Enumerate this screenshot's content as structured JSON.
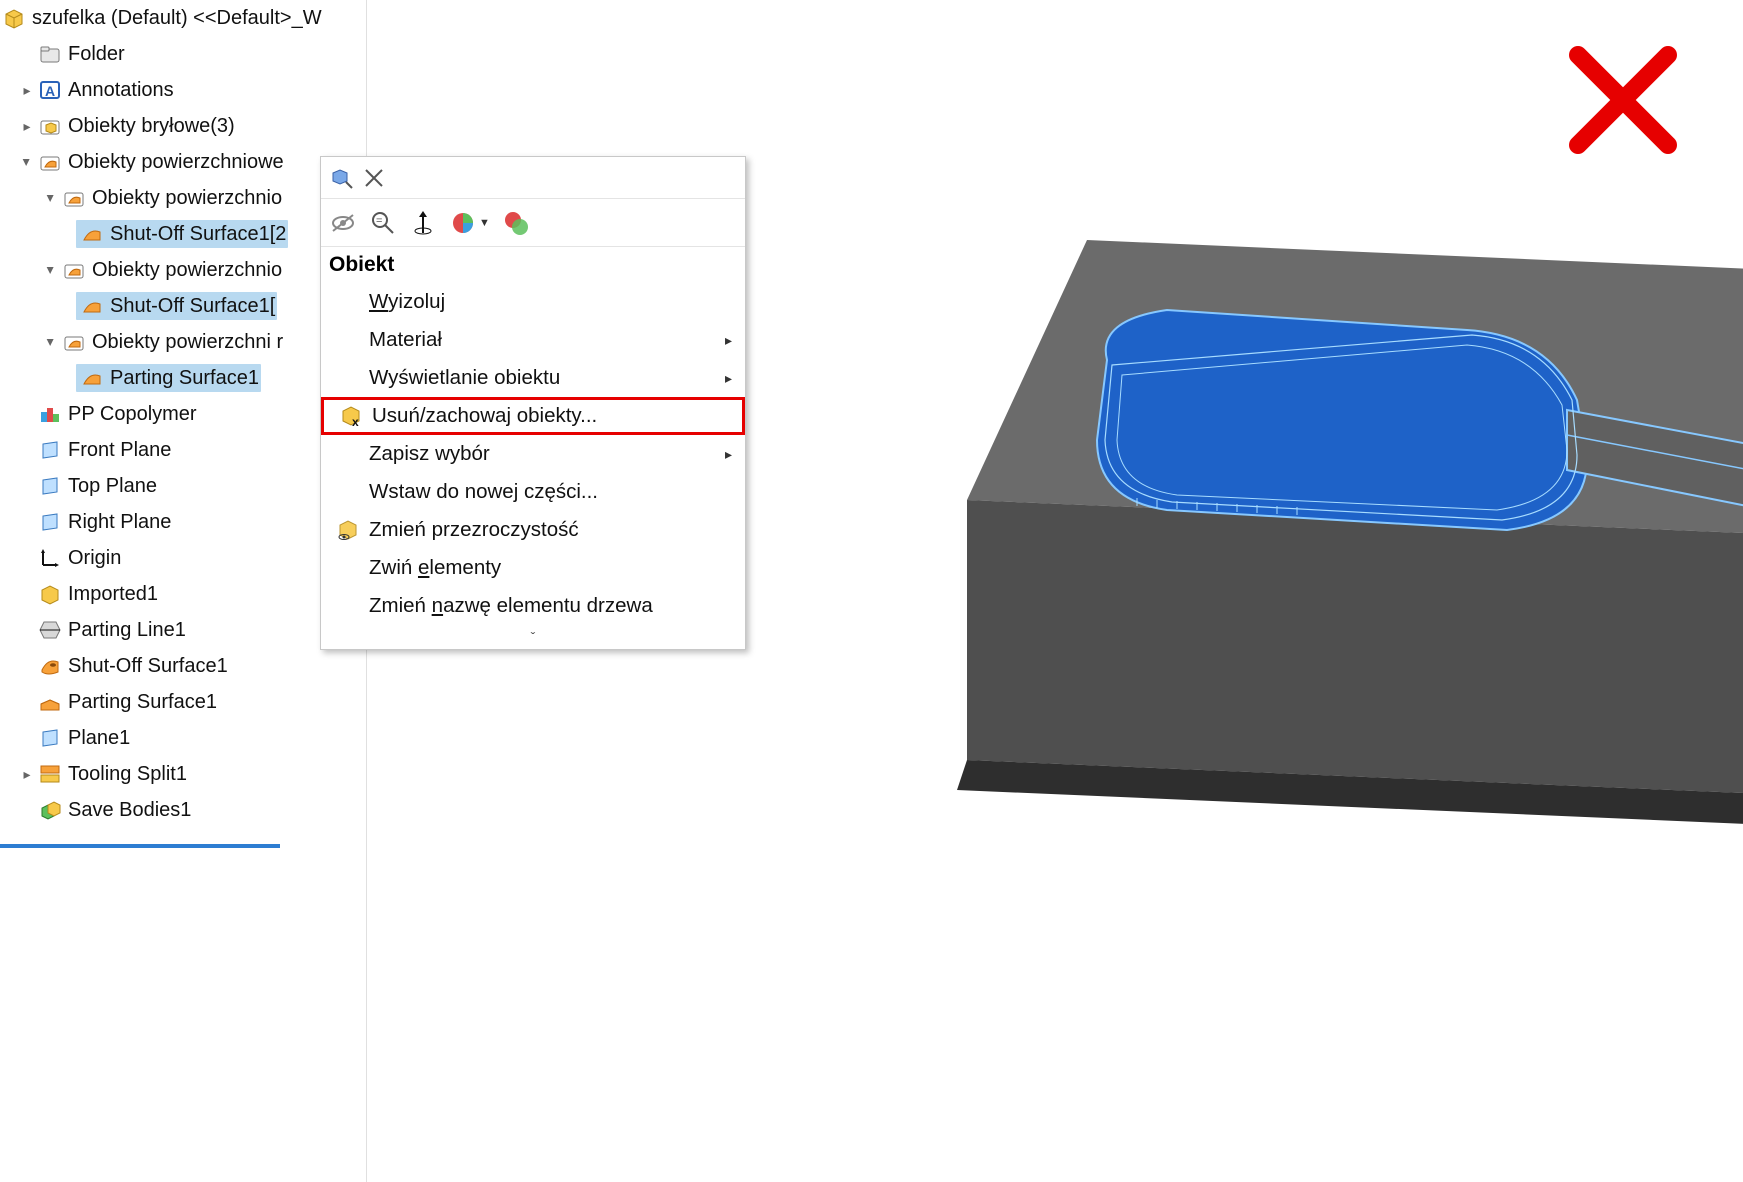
{
  "tree": {
    "root": "szufelka (Default) <<Default>_W",
    "folder": "Folder",
    "annotations": "Annotations",
    "solid_bodies": "Obiekty bryłowe(3)",
    "surface_bodies": "Obiekty powierzchniowe",
    "surface_sub1": "Obiekty powierzchnio",
    "shutoff1": "Shut-Off Surface1[2",
    "surface_sub2": "Obiekty powierzchnio",
    "shutoff2": "Shut-Off Surface1[",
    "parting_folder": "Obiekty powierzchni r",
    "parting_surface_item": "Parting Surface1",
    "material": "PP Copolymer",
    "front": "Front Plane",
    "top": "Top Plane",
    "right": "Right Plane",
    "origin": "Origin",
    "imported": "Imported1",
    "parting_line": "Parting Line1",
    "shutoff_feat": "Shut-Off Surface1",
    "parting_surface_feat": "Parting Surface1",
    "plane1": "Plane1",
    "tooling_split": "Tooling Split1",
    "save_bodies": "Save Bodies1"
  },
  "context_menu": {
    "header": "Obiekt",
    "isolate": "Wyizoluj",
    "material": "Materiał",
    "display": "Wyświetlanie obiektu",
    "delete_keep": "Usuń/zachowaj obiekty...",
    "save_selection": "Zapisz wybór",
    "insert_new_part": "Wstaw do nowej części...",
    "transparency": "Zmień przezroczystość",
    "collapse": "Zwiń elementy",
    "rename": "Zmień nazwę elementu drzewa",
    "expand_hint": "ˇ"
  }
}
